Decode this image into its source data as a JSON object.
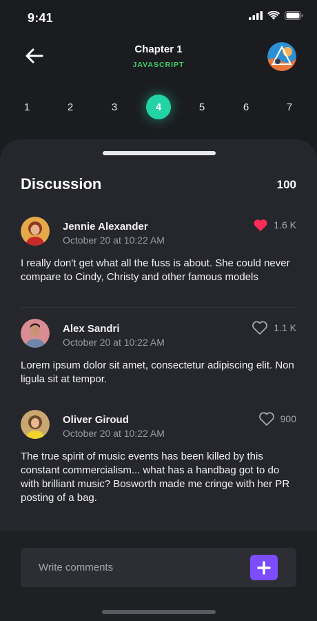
{
  "status": {
    "time": "9:41"
  },
  "header": {
    "back_icon": "arrow-left-icon",
    "title": "Chapter 1",
    "subtitle": "JAVASCRIPT",
    "accent": "#3ecf6a"
  },
  "pager": {
    "pages": [
      "1",
      "2",
      "3",
      "4",
      "5",
      "6",
      "7"
    ],
    "active": "4",
    "active_color": "#22d3a5"
  },
  "discussion": {
    "title": "Discussion",
    "count": "100",
    "comments": [
      {
        "name": "Jennie Alexander",
        "date": "October 20 at 10:22 AM",
        "likes": "1.6 K",
        "liked": true,
        "heart_color": "#ff2d55",
        "text": "I really don't get what all the fuss is about. She could never compare to Cindy, Christy and other famous models"
      },
      {
        "name": "Alex Sandri",
        "date": "October 20 at 10:22 AM",
        "likes": "1.1 K",
        "liked": false,
        "text": "Lorem ipsum dolor sit amet, consectetur adipiscing elit. Non ligula sit at tempor."
      },
      {
        "name": "Oliver Giroud",
        "date": "October 20 at 10:22 AM",
        "likes": "900",
        "liked": false,
        "text": "The true spirit of music events has been killed by this constant commercialism... what has a handbag got to do with brilliant music? Bosworth made me cringe with her PR posting of a bag."
      }
    ]
  },
  "composer": {
    "placeholder": "Write comments",
    "value": "",
    "button_icon": "plus-icon",
    "button_color": "#7c4dff"
  }
}
